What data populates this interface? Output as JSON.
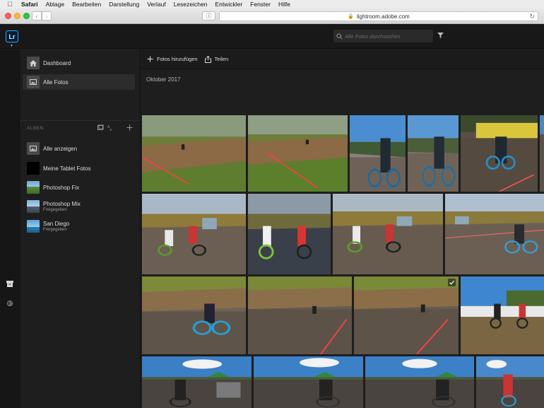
{
  "menubar": {
    "app_name": "Safari",
    "items": [
      "Ablage",
      "Bearbeiten",
      "Darstellung",
      "Verlauf",
      "Lesezeichen",
      "Entwickler",
      "Fenster",
      "Hilfe"
    ]
  },
  "browser": {
    "url": "lightroom.adobe.com"
  },
  "header": {
    "logo_text": "Lr",
    "search_placeholder": "Alle Fotos durchsuchen"
  },
  "sidebar": {
    "nav": [
      {
        "label": "Dashboard",
        "icon": "home-icon"
      },
      {
        "label": "Alle Fotos",
        "icon": "photos-icon",
        "active": true
      }
    ],
    "albums_heading": "ALBEN",
    "albums": [
      {
        "label": "Alle anzeigen",
        "sublabel": ""
      },
      {
        "label": "Meine Tablet Fotos",
        "sublabel": ""
      },
      {
        "label": "Photoshop Fix",
        "sublabel": ""
      },
      {
        "label": "Photoshop Mix",
        "sublabel": "Freigegeben"
      },
      {
        "label": "San Diego",
        "sublabel": "Freigegeben"
      }
    ]
  },
  "toolbar": {
    "add_photos_label": "Fotos hinzufügen",
    "share_label": "Teilen"
  },
  "main": {
    "date_heading": "Oktober 2017"
  },
  "colors": {
    "accent": "#31a8ff",
    "background": "#1e1e1e",
    "panel": "#181818"
  }
}
